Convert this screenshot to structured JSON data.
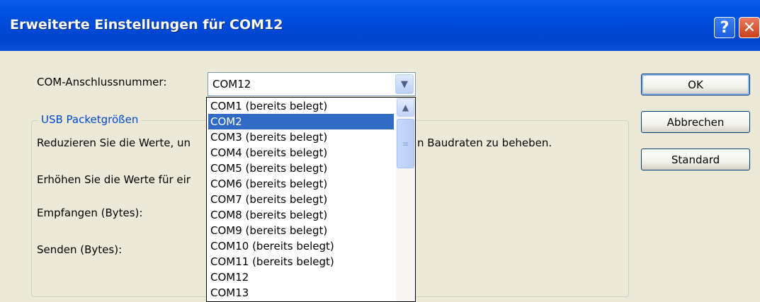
{
  "window": {
    "title": "Erweiterte Einstellungen für COM12",
    "help_glyph": "?",
    "close_glyph": "✕"
  },
  "com_port": {
    "label": "COM-Anschlussnummer:",
    "value": "COM12",
    "dropdown_arrow": "chevron-down-icon",
    "options": [
      "COM1 (bereits belegt)",
      "COM2",
      "COM3 (bereits belegt)",
      "COM4 (bereits belegt)",
      "COM5 (bereits belegt)",
      "COM6 (bereits belegt)",
      "COM7 (bereits belegt)",
      "COM8 (bereits belegt)",
      "COM9 (bereits belegt)",
      "COM10 (bereits belegt)",
      "COM11 (bereits belegt)",
      "COM12",
      "COM13"
    ],
    "highlighted_option": "COM2"
  },
  "usb_group": {
    "title": "USB Packetgrößen",
    "text_reduce_visible_left": "Reduzieren Sie die Werte, un",
    "text_reduce_visible_right": "n Baudraten zu beheben.",
    "text_increase_visible": "Erhöhen Sie die Werte für eir",
    "receive_label": "Empfangen (Bytes):",
    "send_label": "Senden (Bytes):"
  },
  "buttons": {
    "ok": "OK",
    "cancel": "Abbrechen",
    "default": "Standard"
  },
  "colors": {
    "titlebar": "#0054E3",
    "dialog_bg": "#ECE9D8",
    "selection": "#316AC5",
    "group_title": "#0046D5"
  }
}
